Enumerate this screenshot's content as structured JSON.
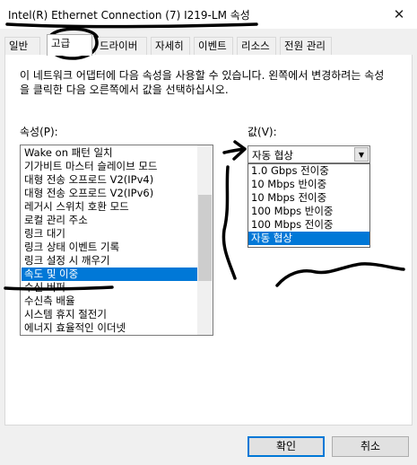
{
  "window": {
    "title": "Intel(R) Ethernet Connection (7) I219-LM 속성",
    "close_glyph": "✕"
  },
  "tabs": [
    {
      "label": "일반"
    },
    {
      "label": "고급"
    },
    {
      "label": "드라이버"
    },
    {
      "label": "자세히"
    },
    {
      "label": "이벤트"
    },
    {
      "label": "리소스"
    },
    {
      "label": "전원 관리"
    }
  ],
  "active_tab": "고급",
  "advanced": {
    "description": "이 네트워크 어댑터에 다음 속성을 사용할 수 있습니다. 왼쪽에서 변경하려는 속성을 클릭한 다음 오른쪽에서 값을 선택하십시오.",
    "property_label": "속성(P):",
    "value_label": "값(V):",
    "properties": [
      "Wake on 패턴 일치",
      "기가비트 마스터 슬레이브 모드",
      "대형 전송 오프로드 V2(IPv4)",
      "대형 전송 오프로드 V2(IPv6)",
      "레거시 스위치 호환 모드",
      "로컬 관리 주소",
      "링크 대기",
      "링크 상태 이벤트 기록",
      "링크 설정 시 깨우기",
      "속도 및 이중",
      "수신 버퍼",
      "수신측 배율",
      "시스템 휴지 절전기",
      "에너지 효율적인 이더넷"
    ],
    "selected_property": "속도 및 이중",
    "value_selected": "자동 협상",
    "value_options": [
      "1.0 Gbps 전이중",
      "10 Mbps 반이중",
      "10 Mbps 전이중",
      "100 Mbps 반이중",
      "100 Mbps 전이중",
      "자동 협상"
    ],
    "dropdown_arrow": "▼"
  },
  "buttons": {
    "ok": "확인",
    "cancel": "취소"
  },
  "colors": {
    "selection": "#0078d7",
    "annotation_ink": "#000000"
  }
}
